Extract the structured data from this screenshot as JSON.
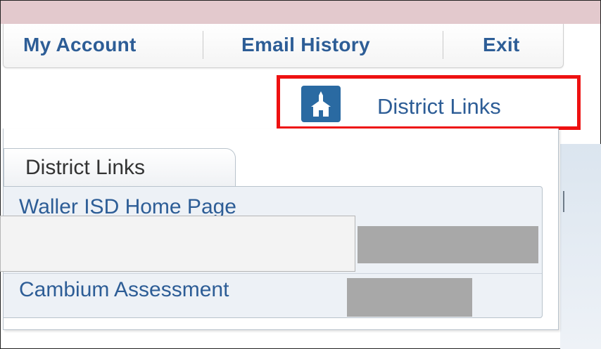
{
  "nav": {
    "my_account": "My Account",
    "email_history": "Email History",
    "exit": "Exit"
  },
  "district_button": {
    "label": "District Links",
    "icon": "schoolhouse-icon"
  },
  "panel": {
    "tab_label": "District Links",
    "links": [
      {
        "label": "Waller ISD Home Page"
      },
      {
        "label": ""
      },
      {
        "label": "Cambium Assessment"
      }
    ]
  },
  "colors": {
    "link": "#2d5d96",
    "highlight_border": "#ee1111",
    "icon_bg": "#2a6aa2",
    "top_strip": "#e3c9cd"
  }
}
